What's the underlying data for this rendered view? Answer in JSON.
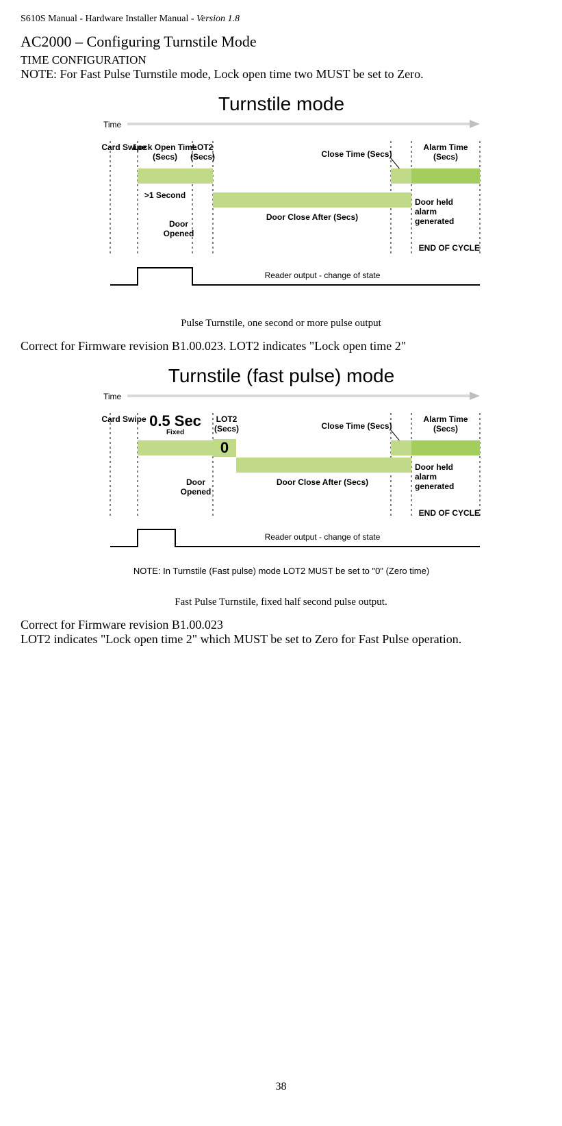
{
  "header": {
    "manual": "S610S Manual",
    "dash1": " - ",
    "doc": "Hardware Installer Manual",
    "dash2": " - ",
    "version": "Version 1.8"
  },
  "title": "AC2000 – Configuring Turnstile Mode",
  "subtitle": "TIME CONFIGURATION",
  "note": "NOTE: For Fast Pulse Turnstile mode, Lock open time two MUST be set to Zero.",
  "diagram1": {
    "title": "Turnstile mode",
    "time_label": "Time",
    "card_swipe": "Card Swipe",
    "lock_open_time_l1": "Lock Open Time",
    "lock_open_time_l2": "(Secs)",
    "lot2_l1": "LOT2",
    "lot2_l2": "(Secs)",
    "gt1sec": ">1 Second",
    "door_l1": "Door",
    "door_l2": "Opened",
    "close_time": "Close Time (Secs)",
    "alarm_l1": "Alarm Time",
    "alarm_l2": "(Secs)",
    "door_close_after": "Door Close After (Secs)",
    "door_held_l1": "Door held",
    "door_held_l2": "alarm",
    "door_held_l3": "generated",
    "end_of_cycle": "END OF CYCLE",
    "reader_output": "Reader output - change of state"
  },
  "caption1": "Pulse Turnstile, one second or more pulse output",
  "body1": "Correct for Firmware revision B1.00.023.  LOT2 indicates \"Lock open time 2\"",
  "diagram2": {
    "title": "Turnstile (fast pulse) mode",
    "time_label": "Time",
    "card_swipe": "Card Swipe",
    "half_sec": "0.5 Sec",
    "fixed": "Fixed",
    "lot2_l1": "LOT2",
    "lot2_l2": "(Secs)",
    "zero": "0",
    "door_l1": "Door",
    "door_l2": "Opened",
    "close_time": "Close Time (Secs)",
    "alarm_l1": "Alarm Time",
    "alarm_l2": "(Secs)",
    "door_close_after": "Door Close After (Secs)",
    "door_held_l1": "Door held",
    "door_held_l2": "alarm",
    "door_held_l3": "generated",
    "end_of_cycle": "END OF CYCLE",
    "reader_output": "Reader output - change of state",
    "footnote": "NOTE: In Turnstile (Fast pulse) mode LOT2 MUST be set to \"0\" (Zero time)"
  },
  "caption2": "Fast Pulse Turnstile, fixed half second pulse output.",
  "body2a": "Correct for Firmware revision B1.00.023",
  "body2b": "LOT2 indicates \"Lock open time 2\" which MUST be set to Zero for Fast Pulse operation.",
  "page_number": "38"
}
